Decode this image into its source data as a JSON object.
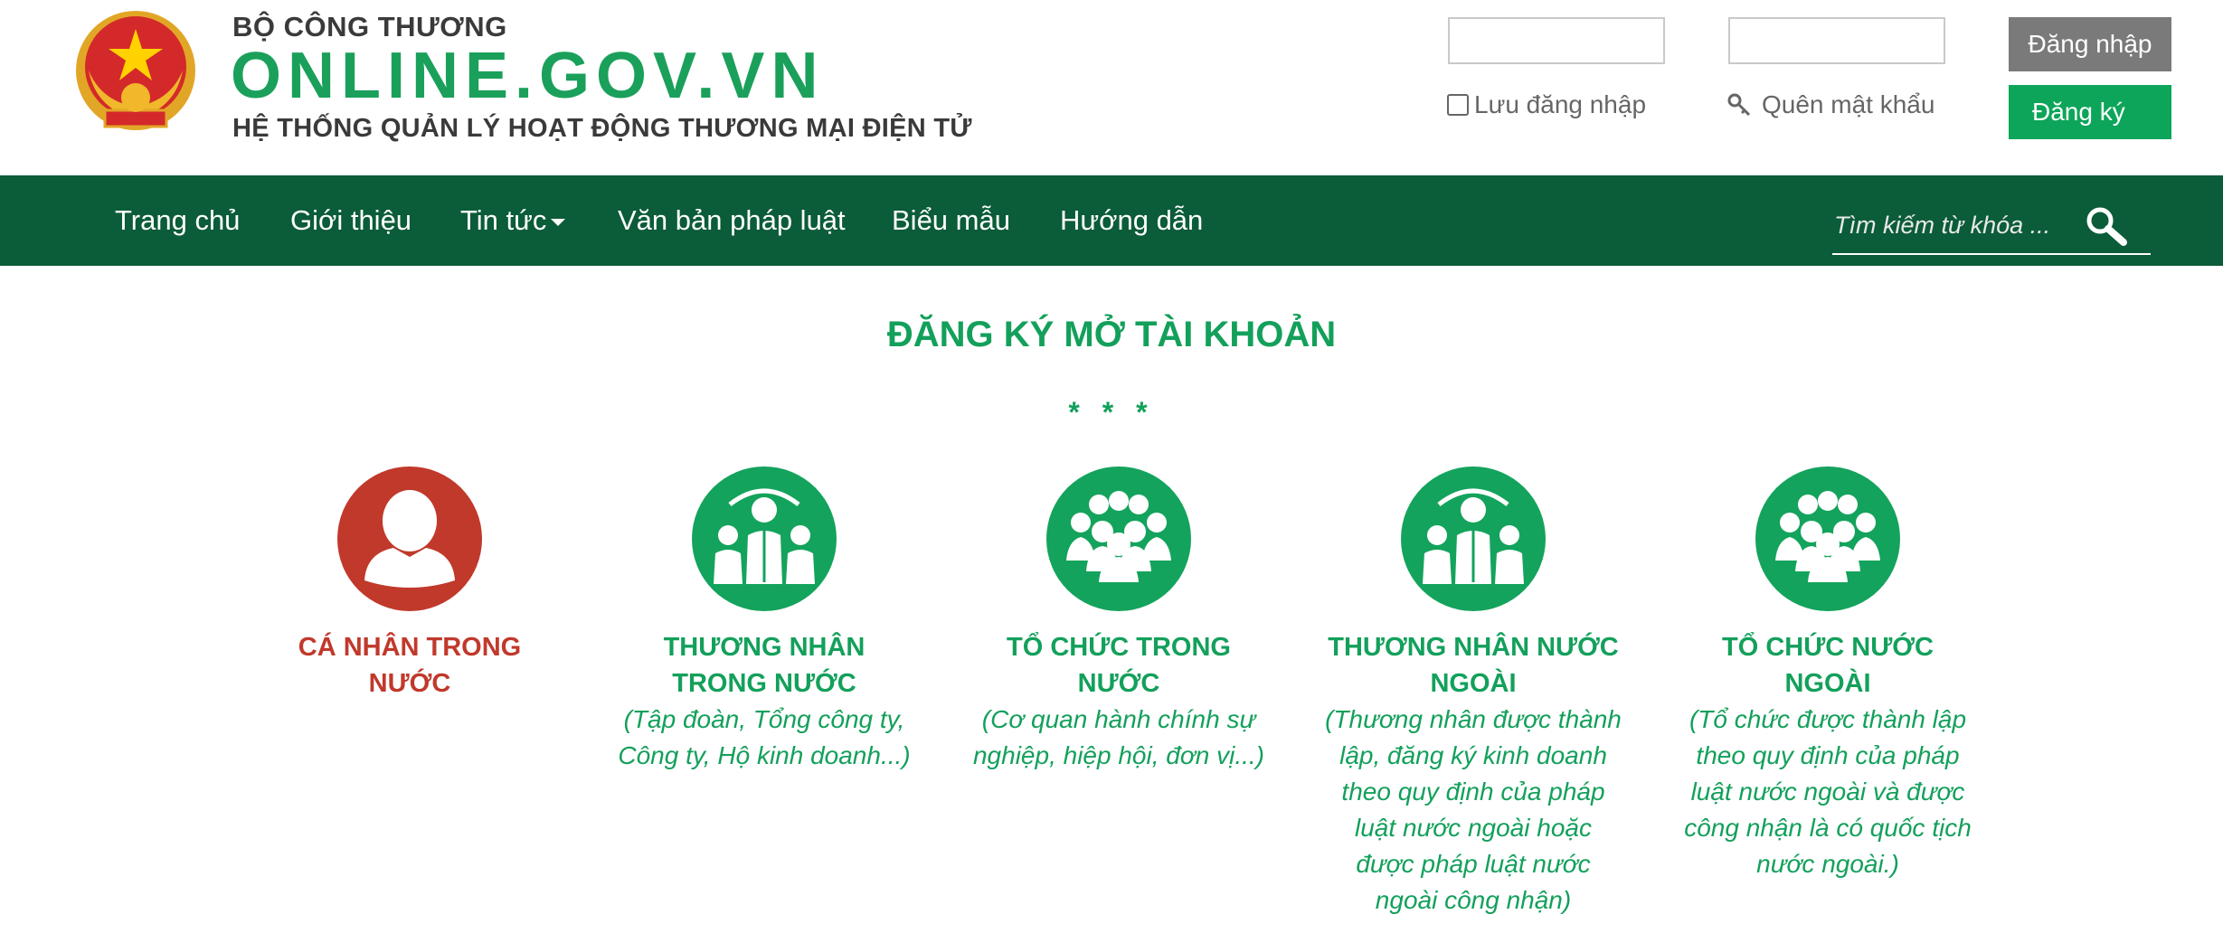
{
  "header": {
    "ministry": "BỘ CÔNG THƯƠNG",
    "site_name": "ONLINE.GOV.VN",
    "system_name": "HỆ THỐNG QUẢN LÝ HOẠT ĐỘNG THƯƠNG MẠI ĐIỆN TỬ",
    "login": {
      "username_value": "",
      "password_value": "",
      "login_button": "Đăng nhập",
      "register_button": "Đăng ký",
      "remember_label": "Lưu đăng nhập",
      "forgot_label": "Quên mật khẩu"
    }
  },
  "nav": {
    "items": [
      "Trang chủ",
      "Giới thiệu",
      "Tin tức",
      "Văn bản pháp luật",
      "Biểu mẫu",
      "Hướng dẫn"
    ],
    "search_placeholder": "Tìm kiếm từ khóa ..."
  },
  "main": {
    "title": "ĐĂNG KÝ MỞ TÀI KHOẢN",
    "divider": "* * *",
    "cards": [
      {
        "icon": "person-icon",
        "title": "CÁ NHÂN TRONG NƯỚC",
        "description": "",
        "color": "#c0392b"
      },
      {
        "icon": "businessmen-icon",
        "title": "THƯƠNG NHÂN TRONG NƯỚC",
        "description": "(Tập đoàn, Tổng công ty, Công ty, Hộ kinh doanh...)",
        "color": "#13a05b"
      },
      {
        "icon": "group-icon",
        "title": "TỔ CHỨC TRONG NƯỚC",
        "description": "(Cơ quan hành chính sự nghiệp, hiệp hội, đơn vị...)",
        "color": "#13a05b"
      },
      {
        "icon": "businessmen-icon",
        "title": "THƯƠNG NHÂN NƯỚC NGOÀI",
        "description": "(Thương nhân được thành lập, đăng ký kinh doanh theo quy định của pháp luật nước ngoài hoặc được pháp luật nước ngoài công nhận)",
        "color": "#13a05b"
      },
      {
        "icon": "group-icon",
        "title": "TỔ CHỨC NƯỚC NGOÀI",
        "description": "(Tổ chức được thành lập theo quy định của pháp luật nước ngoài và được công nhận là có quốc tịch nước ngoài.)",
        "color": "#13a05b"
      }
    ]
  },
  "colors": {
    "nav_background": "#0b5c38",
    "brand_green": "#13a05b",
    "accent_red": "#c0392b",
    "login_button": "#7a7a7a",
    "register_button": "#0da55a"
  }
}
